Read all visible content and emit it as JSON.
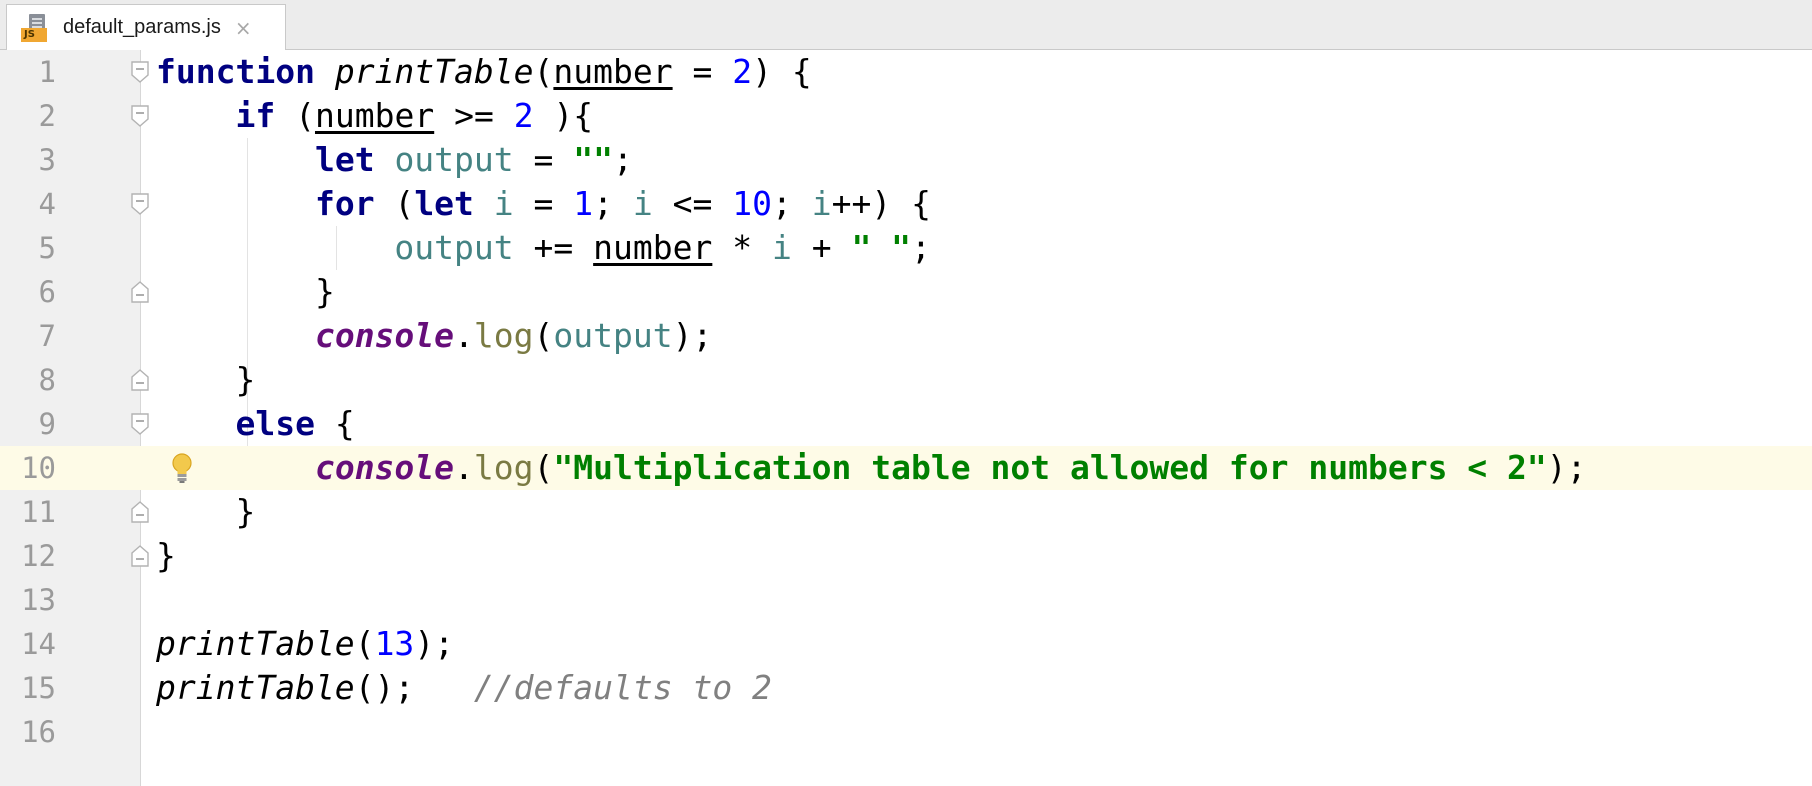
{
  "tab": {
    "filename": "default_params.js",
    "badge": "JS",
    "close_glyph": "×"
  },
  "icons": {
    "file": "js-file-icon",
    "close": "close-icon",
    "fold": "fold-marker-icon",
    "intention": "lightbulb-icon"
  },
  "colors": {
    "keyword": "#000080",
    "number": "#0000ff",
    "string": "#008000",
    "local_variable": "#458383",
    "global": "#660e7a",
    "method": "#7a7a43",
    "comment": "#808080",
    "current_line": "#fefbe7"
  },
  "current_line": 10,
  "code": {
    "lines": [
      {
        "number": "1",
        "t": [
          "function",
          " ",
          "printTable",
          "(",
          "number",
          " = ",
          "2",
          ") {"
        ]
      },
      {
        "number": "2",
        "t": [
          "    ",
          "if",
          " (",
          "number",
          " >= ",
          "2",
          " ){"
        ]
      },
      {
        "number": "3",
        "t": [
          "        ",
          "let",
          " ",
          "output",
          " = ",
          "\"\"",
          ";"
        ]
      },
      {
        "number": "4",
        "t": [
          "        ",
          "for",
          " (",
          "let",
          " ",
          "i",
          " = ",
          "1",
          "; ",
          "i",
          " <= ",
          "10",
          "; ",
          "i",
          "++) {"
        ]
      },
      {
        "number": "5",
        "t": [
          "            ",
          "output",
          " += ",
          "number",
          " * ",
          "i",
          " + ",
          "\" \"",
          ";"
        ]
      },
      {
        "number": "6",
        "t": [
          "        }"
        ]
      },
      {
        "number": "7",
        "t": [
          "        ",
          "console",
          ".",
          "log",
          "(",
          "output",
          ");"
        ]
      },
      {
        "number": "8",
        "t": [
          "    }"
        ]
      },
      {
        "number": "9",
        "t": [
          "    ",
          "else",
          " {"
        ]
      },
      {
        "number": "10",
        "t": [
          "        ",
          "console",
          ".",
          "log",
          "(",
          "\"Multiplication table not allowed for numbers < 2\"",
          ");"
        ]
      },
      {
        "number": "11",
        "t": [
          "    }"
        ]
      },
      {
        "number": "12",
        "t": [
          "}"
        ]
      },
      {
        "number": "13",
        "t": [
          ""
        ]
      },
      {
        "number": "14",
        "t": [
          "printTable",
          "(",
          "13",
          ");"
        ]
      },
      {
        "number": "15",
        "t": [
          "printTable",
          "();",
          "   ",
          "//defaults to 2"
        ]
      },
      {
        "number": "16",
        "t": [
          ""
        ]
      }
    ]
  }
}
